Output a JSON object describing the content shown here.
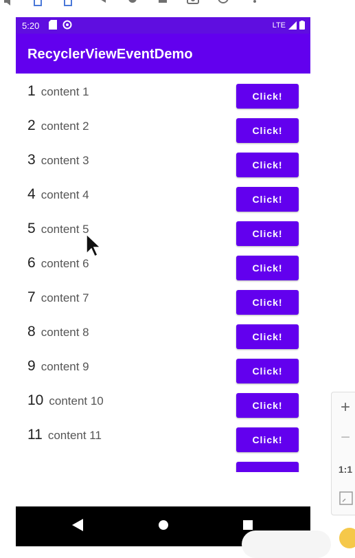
{
  "status_bar": {
    "time": "5:20",
    "network": "LTE"
  },
  "app_bar": {
    "title": "RecyclerViewEventDemo"
  },
  "list": {
    "items": [
      {
        "number": "1",
        "content": "content 1",
        "button": "Click!"
      },
      {
        "number": "2",
        "content": "content 2",
        "button": "Click!"
      },
      {
        "number": "3",
        "content": "content 3",
        "button": "Click!"
      },
      {
        "number": "4",
        "content": "content 4",
        "button": "Click!"
      },
      {
        "number": "5",
        "content": "content 5",
        "button": "Click!"
      },
      {
        "number": "6",
        "content": "content 6",
        "button": "Click!"
      },
      {
        "number": "7",
        "content": "content 7",
        "button": "Click!"
      },
      {
        "number": "8",
        "content": "content 8",
        "button": "Click!"
      },
      {
        "number": "9",
        "content": "content 9",
        "button": "Click!"
      },
      {
        "number": "10",
        "content": "content 10",
        "button": "Click!"
      },
      {
        "number": "11",
        "content": "content 11",
        "button": "Click!"
      }
    ]
  },
  "side_panel": {
    "zoom_in": "+",
    "zoom_out": "−",
    "actual_size": "1:1"
  },
  "colors": {
    "primary": "#6200ee",
    "status_bar": "#5f0ee0",
    "nav_bar": "#000000"
  },
  "icons": {
    "emulator_toolbar": [
      "volume-icon",
      "rotate-left-icon",
      "rotate-right-icon",
      "back-icon",
      "home-icon",
      "overview-icon",
      "screenshot-icon",
      "zoom-icon",
      "more-icon"
    ],
    "navigation": [
      "nav-back-icon",
      "nav-home-icon",
      "nav-recents-icon"
    ]
  }
}
